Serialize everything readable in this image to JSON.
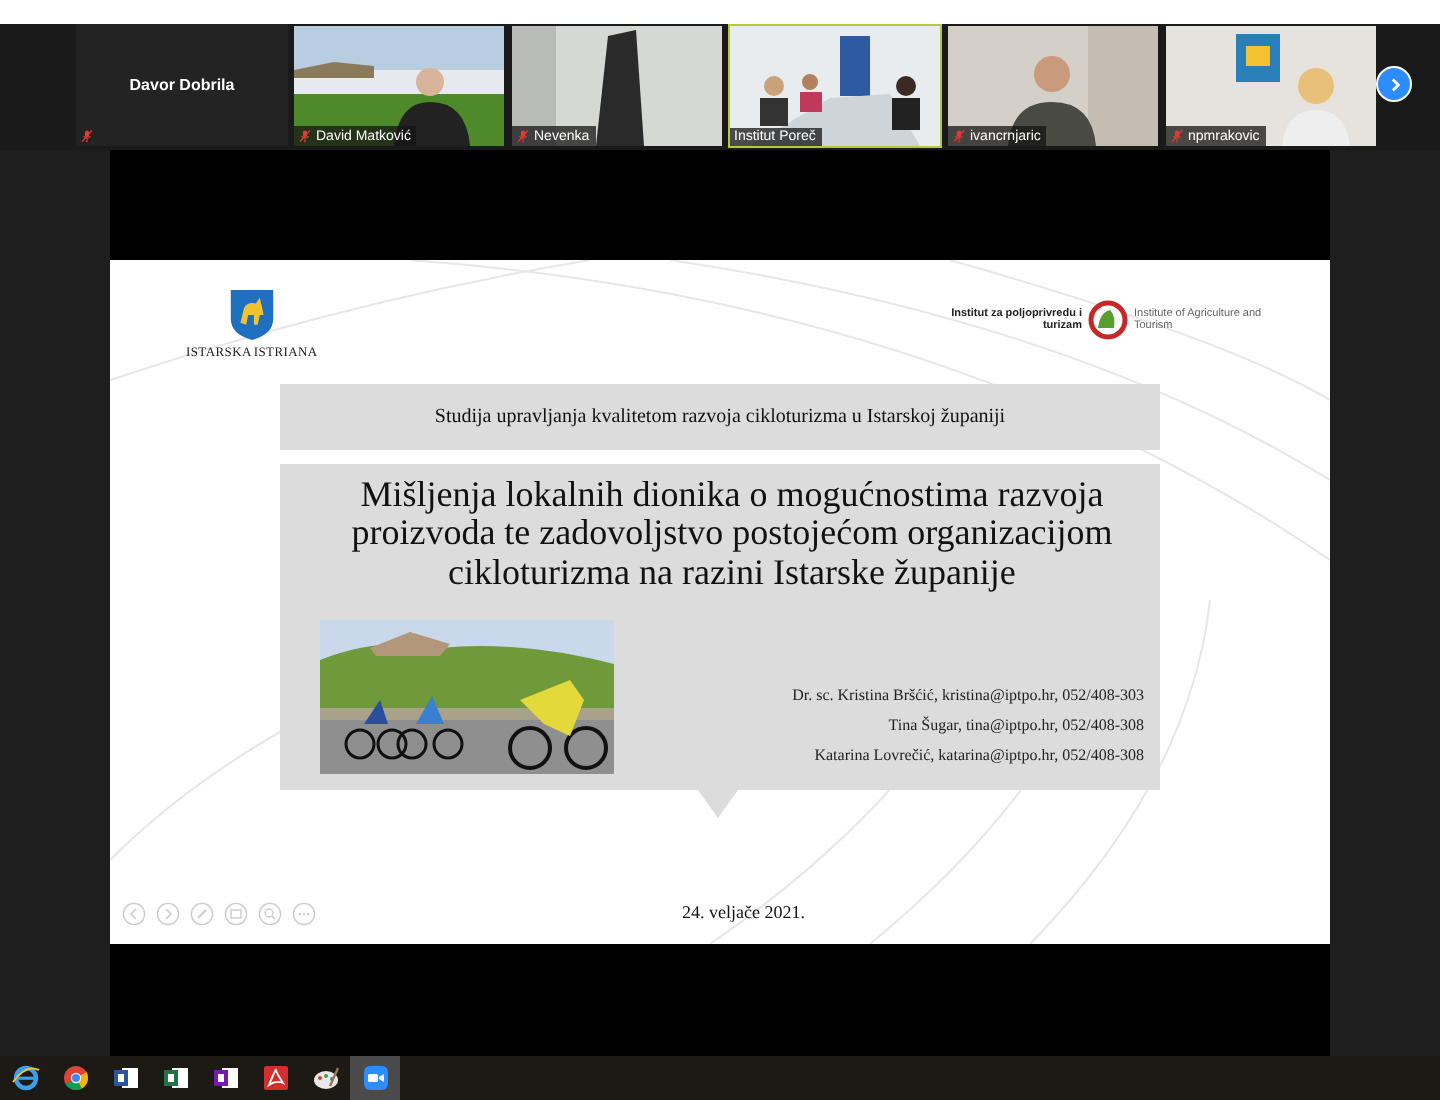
{
  "gallery": {
    "active_speaker": {
      "name": "Davor Dobrila",
      "muted": true
    },
    "participants": [
      {
        "name": "David Matković",
        "muted": true,
        "speaking": false
      },
      {
        "name": "Nevenka",
        "muted": true,
        "speaking": false
      },
      {
        "name": "Institut Poreč",
        "muted": false,
        "speaking": true
      },
      {
        "name": "ivancrnjaric",
        "muted": true,
        "speaking": false
      },
      {
        "name": "npmrakovic",
        "muted": true,
        "speaking": false
      }
    ]
  },
  "slide": {
    "logo_left": [
      "ISTARSKA",
      "ISTRIANA"
    ],
    "logo_right": {
      "name": "Institut za poljoprivredu i turizam",
      "name_en": "Institute of Agriculture and Tourism"
    },
    "subtitle": "Studija upravljanja kvalitetom razvoja cikloturizma u Istarskoj županiji",
    "title": "Mišljenja lokalnih dionika o mogućnostima razvoja proizvoda te zadovoljstvo postojećom organizacijom cikloturizma na razini Istarske županije",
    "authors": [
      "Dr. sc. Kristina Bršćić, kristina@iptpo.hr, 052/408-303",
      "Tina Šugar, tina@iptpo.hr, 052/408-308",
      "Katarina Lovrečić, katarina@iptpo.hr, 052/408-308"
    ],
    "date": "24. veljače 2021.",
    "controls": [
      {
        "kind": "back"
      },
      {
        "kind": "forward"
      },
      {
        "kind": "pen"
      },
      {
        "kind": "slides"
      },
      {
        "kind": "zoom"
      },
      {
        "kind": "more"
      }
    ]
  },
  "taskbar": [
    {
      "kind": "browser",
      "selected": false
    },
    {
      "kind": "chrome",
      "selected": false
    },
    {
      "kind": "word",
      "selected": false
    },
    {
      "kind": "excel",
      "selected": false
    },
    {
      "kind": "onenote",
      "selected": false
    },
    {
      "kind": "pdf",
      "selected": false
    },
    {
      "kind": "paint",
      "selected": false
    },
    {
      "kind": "camera",
      "selected": true
    }
  ]
}
